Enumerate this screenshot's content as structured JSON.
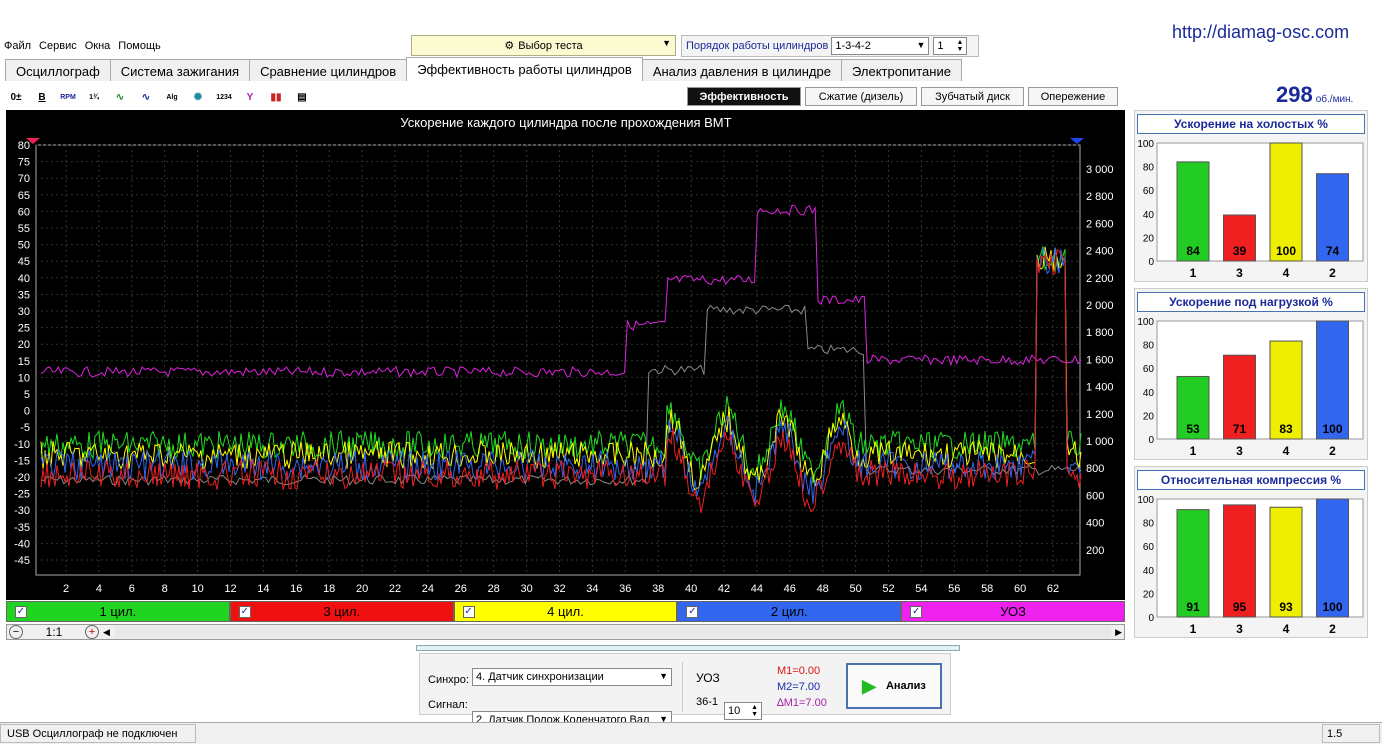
{
  "site_url": "http://diamag-osc.com",
  "menu": [
    "Файл",
    "Сервис",
    "Окна",
    "Помощь"
  ],
  "test_select": "Выбор теста",
  "order": {
    "label": "Порядок работы цилиндров",
    "value": "1-3-4-2",
    "spin": "1"
  },
  "tabs": [
    "Осциллограф",
    "Система зажигания",
    "Сравнение цилиндров",
    "Эффективность работы цилиндров",
    "Анализ давления в цилиндре",
    "Электропитание"
  ],
  "active_tab": 3,
  "subtabs": [
    "Эффективность",
    "Сжатие (дизель)",
    "Зубчатый диск",
    "Опережение"
  ],
  "rpm": {
    "value": "298",
    "unit": "об./мин."
  },
  "plot": {
    "title": "Ускорение каждого цилиндра после прохождения ВМТ",
    "y_left": [
      "80",
      "75",
      "70",
      "65",
      "60",
      "55",
      "50",
      "45",
      "40",
      "35",
      "30",
      "25",
      "20",
      "15",
      "10",
      "5",
      "0",
      "-5",
      "-10",
      "-15",
      "-20",
      "-25",
      "-30",
      "-35",
      "-40",
      "-45"
    ],
    "y_right": [
      "3 000",
      "2 800",
      "2 600",
      "2 400",
      "2 200",
      "2 000",
      "1 800",
      "1 600",
      "1 400",
      "1 200",
      "1 000",
      "800",
      "600",
      "400",
      "200"
    ],
    "x_ticks": [
      "2",
      "4",
      "6",
      "8",
      "10",
      "12",
      "14",
      "16",
      "18",
      "20",
      "22",
      "24",
      "26",
      "28",
      "30",
      "32",
      "34",
      "36",
      "38",
      "40",
      "42",
      "44",
      "46",
      "48",
      "50",
      "52",
      "54",
      "56",
      "58",
      "60",
      "62"
    ]
  },
  "channels": [
    {
      "label": "1 цил.",
      "color": "#22d422"
    },
    {
      "label": "3 цил.",
      "color": "#f01010"
    },
    {
      "label": "4 цил.",
      "color": "#ffff00"
    },
    {
      "label": "2 цил.",
      "color": "#3366ee"
    },
    {
      "label": "УОЗ",
      "color": "#ee22ee"
    }
  ],
  "scale": "1:1",
  "panels": [
    {
      "title": "Ускорение на холостых %",
      "cyl": [
        "1",
        "3",
        "4",
        "2"
      ],
      "values": [
        84,
        39,
        100,
        74
      ]
    },
    {
      "title": "Ускорение под нагрузкой %",
      "cyl": [
        "1",
        "3",
        "4",
        "2"
      ],
      "values": [
        53,
        71,
        83,
        100
      ]
    },
    {
      "title": "Относительная компрессия %",
      "cyl": [
        "1",
        "3",
        "4",
        "2"
      ],
      "values": [
        91,
        95,
        93,
        100
      ]
    }
  ],
  "bar_colors": [
    "#22cc22",
    "#ee2020",
    "#eeee00",
    "#3366ee"
  ],
  "y_ticks": [
    "100",
    "80",
    "60",
    "40",
    "20",
    "0"
  ],
  "bottom": {
    "sync_label": "Синхро:",
    "sync_value": "4.  Датчик синхронизации",
    "signal_label": "Сигнал:",
    "signal_value": "2.  Датчик Полож Коленчатого Вал",
    "uoz_label": "УОЗ",
    "uoz_value": "10",
    "sub": "36-1",
    "m1": "M1=0.00",
    "m2": "M2=7.00",
    "dm1": "∆M1=7.00",
    "analyze": "Анализ"
  },
  "status": {
    "left": "USB Осциллограф не подключен",
    "right": "1.5"
  }
}
